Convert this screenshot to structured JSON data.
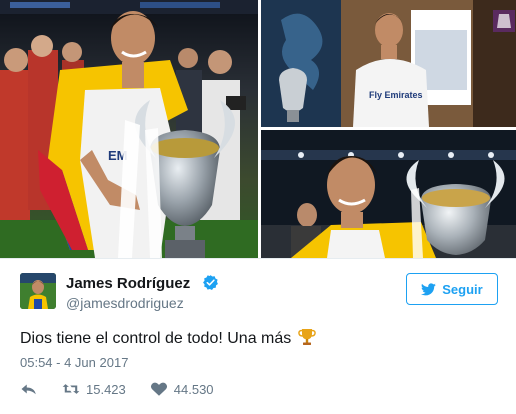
{
  "tweet": {
    "display_name": "James Rodríguez",
    "handle": "@jamesdrodriguez",
    "follow_label": "Seguir",
    "text": "Dios tiene el control de todo! Una más",
    "timestamp": "05:54 - 4 Jun 2017",
    "retweet_count": "15.423",
    "like_count": "44.530"
  },
  "colors": {
    "twitter_blue": "#1da1f2",
    "muted_text": "#657786",
    "verified_badge": "#1da1f2",
    "trophy_gold": "#e8a317"
  },
  "icons": {
    "verified": "verified-badge-icon",
    "follow": "twitter-bird-icon",
    "reply": "reply-icon",
    "retweet": "retweet-icon",
    "like": "heart-icon",
    "trophy": "trophy-emoji-icon"
  },
  "photos": {
    "main_jersey_text": "EM",
    "top_right_jersey_text": "Fly Emirates"
  }
}
